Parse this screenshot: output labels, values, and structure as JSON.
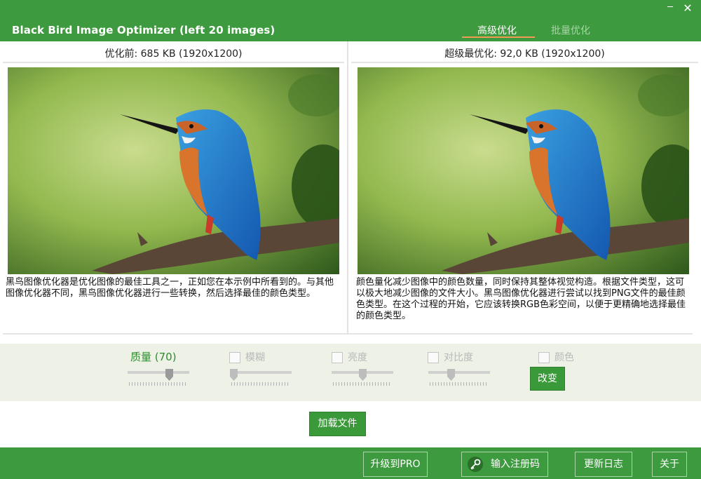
{
  "window": {
    "title": "Black Bird Image Optimizer (left 20 images)",
    "minimize_icon": "minimize-icon",
    "close_icon": "close-icon"
  },
  "tabs": [
    {
      "label": "高级优化",
      "active": true
    },
    {
      "label": "批量优化",
      "active": false
    }
  ],
  "left_panel": {
    "caption": "优化前: 685 KB (1920x1200)",
    "description": "黑鸟图像优化器是优化图像的最佳工具之一，正如您在本示例中所看到的。与其他图像优化器不同，黑鸟图像优化器进行一些转换，然后选择最佳的颜色类型。"
  },
  "right_panel": {
    "caption": "超级最优化: 92,0 KB (1920x1200)",
    "description": "颜色量化减少图像中的颜色数量，同时保持其整体视觉构造。根据文件类型，这可以极大地减少图像的文件大小。黑鸟图像优化器进行尝试以找到PNG文件的最佳颜色类型。在这个过程的开始，它应该转换RGB色彩空间，以便于更精确地选择最佳的颜色类型。"
  },
  "controls": {
    "quality": {
      "label": "质量 (70)",
      "value": 0.7
    },
    "blur": {
      "label": "模糊",
      "checked": false,
      "value": 0.0
    },
    "brightness": {
      "label": "亮度",
      "checked": false,
      "value": 0.5
    },
    "contrast": {
      "label": "对比度",
      "checked": false,
      "value": 0.35
    },
    "color": {
      "label": "颜色",
      "checked": false
    },
    "change_button": "改变"
  },
  "load_button": "加载文件",
  "footer": {
    "upgrade_button": "升级到PRO",
    "register_button": "输入注册码",
    "changelog_button": "更新日志",
    "about_button": "关于"
  },
  "colors": {
    "brand_green": "#3e9a3e",
    "tab_underline": "#f39a52",
    "controls_bg": "#eef2e6"
  }
}
